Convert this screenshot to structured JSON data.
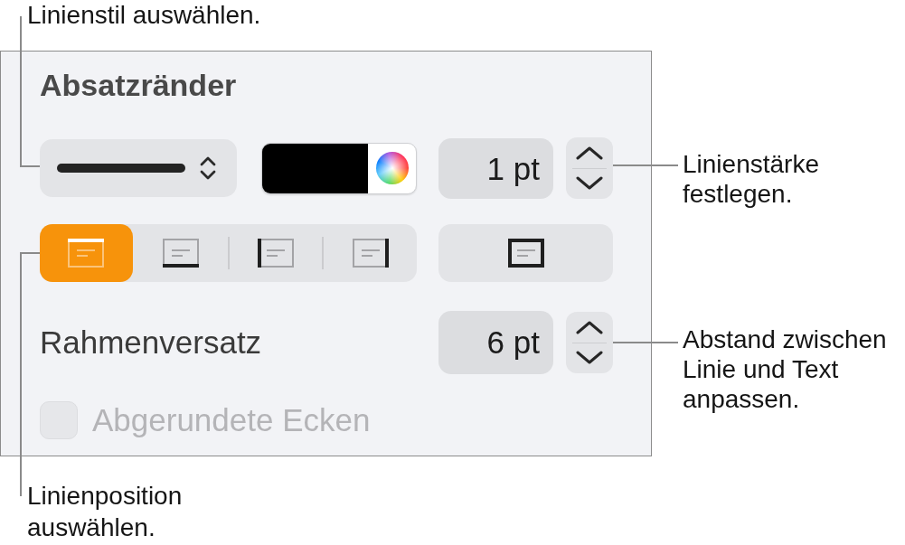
{
  "callouts": [
    {
      "text": "Linienstil auswählen."
    },
    {
      "text": "Linienstärke festlegen."
    },
    {
      "text": "Abstand zwischen Linie und Text anpassen."
    },
    {
      "text": "Linienposition auswählen."
    }
  ],
  "panel": {
    "title": "Absatzränder",
    "line_style": {
      "kind": "solid"
    },
    "color_well": {
      "color": "#000000"
    },
    "line_width": {
      "value": "1 pt"
    },
    "positions": [
      {
        "kind": "top",
        "selected": true
      },
      {
        "kind": "bottom",
        "selected": false
      },
      {
        "kind": "left",
        "selected": false
      },
      {
        "kind": "right",
        "selected": false
      }
    ],
    "offset": {
      "label": "Rahmenversatz",
      "value": "6 pt"
    },
    "rounded_corners": {
      "label": "Abgerundete Ecken",
      "checked": false,
      "disabled": true
    }
  }
}
